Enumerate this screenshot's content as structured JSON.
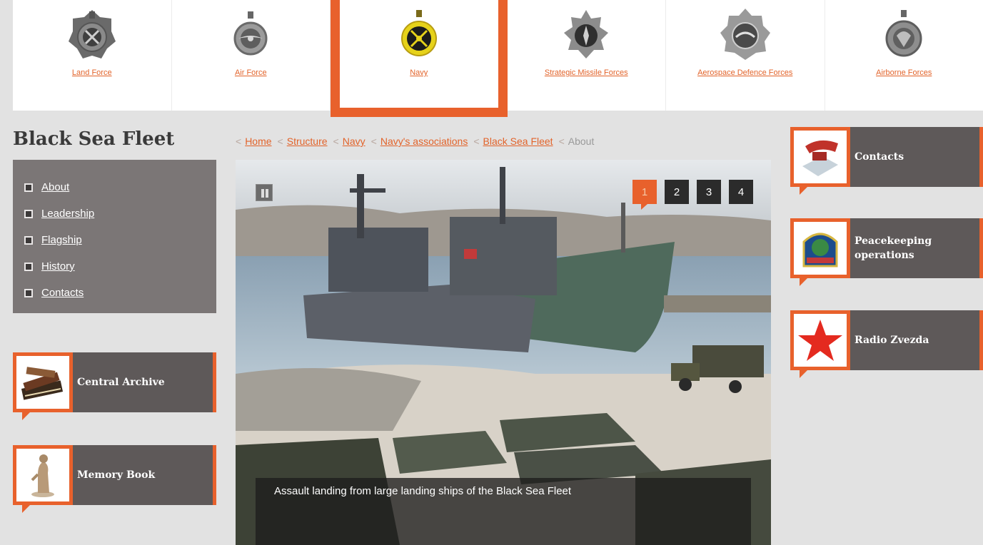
{
  "branches": [
    {
      "label": "Land Force",
      "icon": "land-force-emblem-icon"
    },
    {
      "label": "Air Force",
      "icon": "air-force-emblem-icon"
    },
    {
      "label": "Navy",
      "icon": "navy-emblem-icon"
    },
    {
      "label": "Strategic Missile Forces",
      "icon": "missile-forces-emblem-icon"
    },
    {
      "label": "Aerospace Defence Forces",
      "icon": "aerospace-defence-emblem-icon"
    },
    {
      "label": "Airborne Forces",
      "icon": "airborne-forces-emblem-icon"
    }
  ],
  "page_title": "Black Sea Fleet",
  "left_menu": [
    {
      "label": "About"
    },
    {
      "label": "Leadership"
    },
    {
      "label": "Flagship"
    },
    {
      "label": "History"
    },
    {
      "label": "Contacts"
    }
  ],
  "left_promos": [
    {
      "label": "Central Archive",
      "icon": "archive-books-icon"
    },
    {
      "label": "Memory Book",
      "icon": "memorial-statue-icon"
    }
  ],
  "breadcrumb": {
    "separator": "<",
    "links": [
      "Home",
      "Structure",
      "Navy",
      "Navy's associations",
      "Black Sea Fleet"
    ],
    "current": "About"
  },
  "slider": {
    "pages": [
      "1",
      "2",
      "3",
      "4"
    ],
    "active_page": "1",
    "caption": "Assault landing from large landing ships of the Black Sea Fleet"
  },
  "right_promos": [
    {
      "label": "Contacts",
      "icon": "telephone-icon"
    },
    {
      "label": "Peacekeeping operations",
      "icon": "peacekeeping-badge-icon"
    },
    {
      "label": "Radio Zvezda",
      "icon": "red-star-icon"
    }
  ],
  "colors": {
    "accent": "#e8612c",
    "promo_bg": "#5e5959",
    "menu_bg": "#7b7676",
    "page_bg": "#e2e2e2"
  }
}
